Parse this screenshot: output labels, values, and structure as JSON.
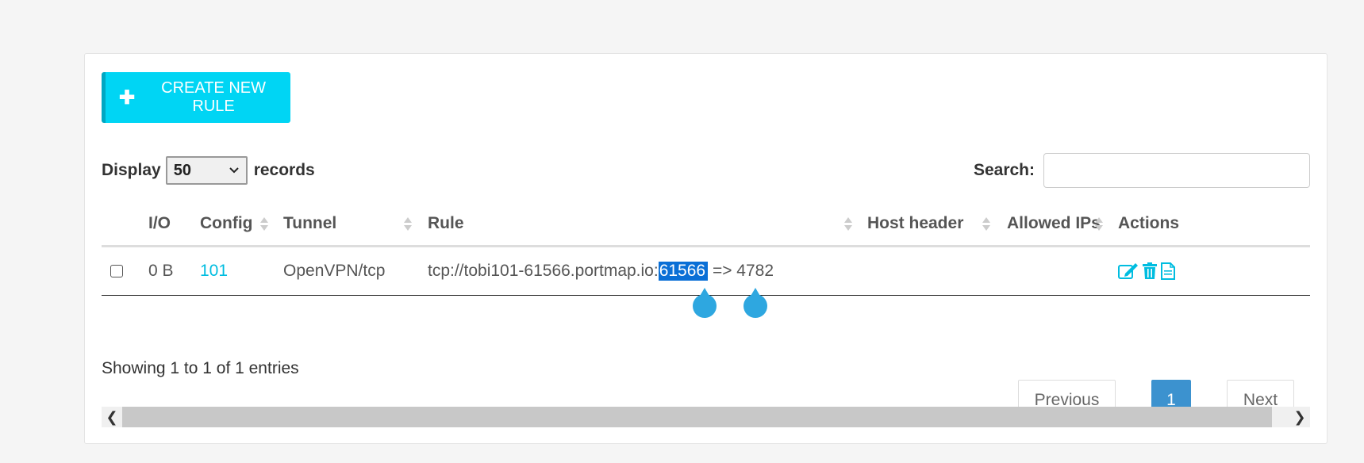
{
  "toolbar": {
    "create_label": "CREATE NEW RULE",
    "create_icon": "plus-icon"
  },
  "length": {
    "prefix": "Display",
    "value": "50",
    "suffix": "records"
  },
  "search": {
    "label": "Search:",
    "value": "",
    "placeholder": ""
  },
  "table": {
    "columns": [
      "I/O",
      "Config",
      "Tunnel",
      "Rule",
      "Host header",
      "Allowed IPs",
      "Actions"
    ],
    "rows": [
      {
        "io": "0 B",
        "config": "101",
        "tunnel": "OpenVPN/tcp",
        "rule_prefix": "tcp://tobi101-61566.portmap.io:",
        "rule_selected": "61566",
        "rule_suffix": " => 4782",
        "host_header": "",
        "allowed_ips": "",
        "actions": [
          "edit-icon",
          "trash-icon",
          "document-icon"
        ]
      }
    ]
  },
  "info": {
    "text": "Showing 1 to 1 of 1 entries"
  },
  "pagination": {
    "previous": "Previous",
    "current": "1",
    "next": "Next"
  },
  "colors": {
    "accent": "#00d5f4",
    "link": "#00bde0",
    "page_active": "#3c92cf",
    "selection": "#0a6fd6"
  }
}
